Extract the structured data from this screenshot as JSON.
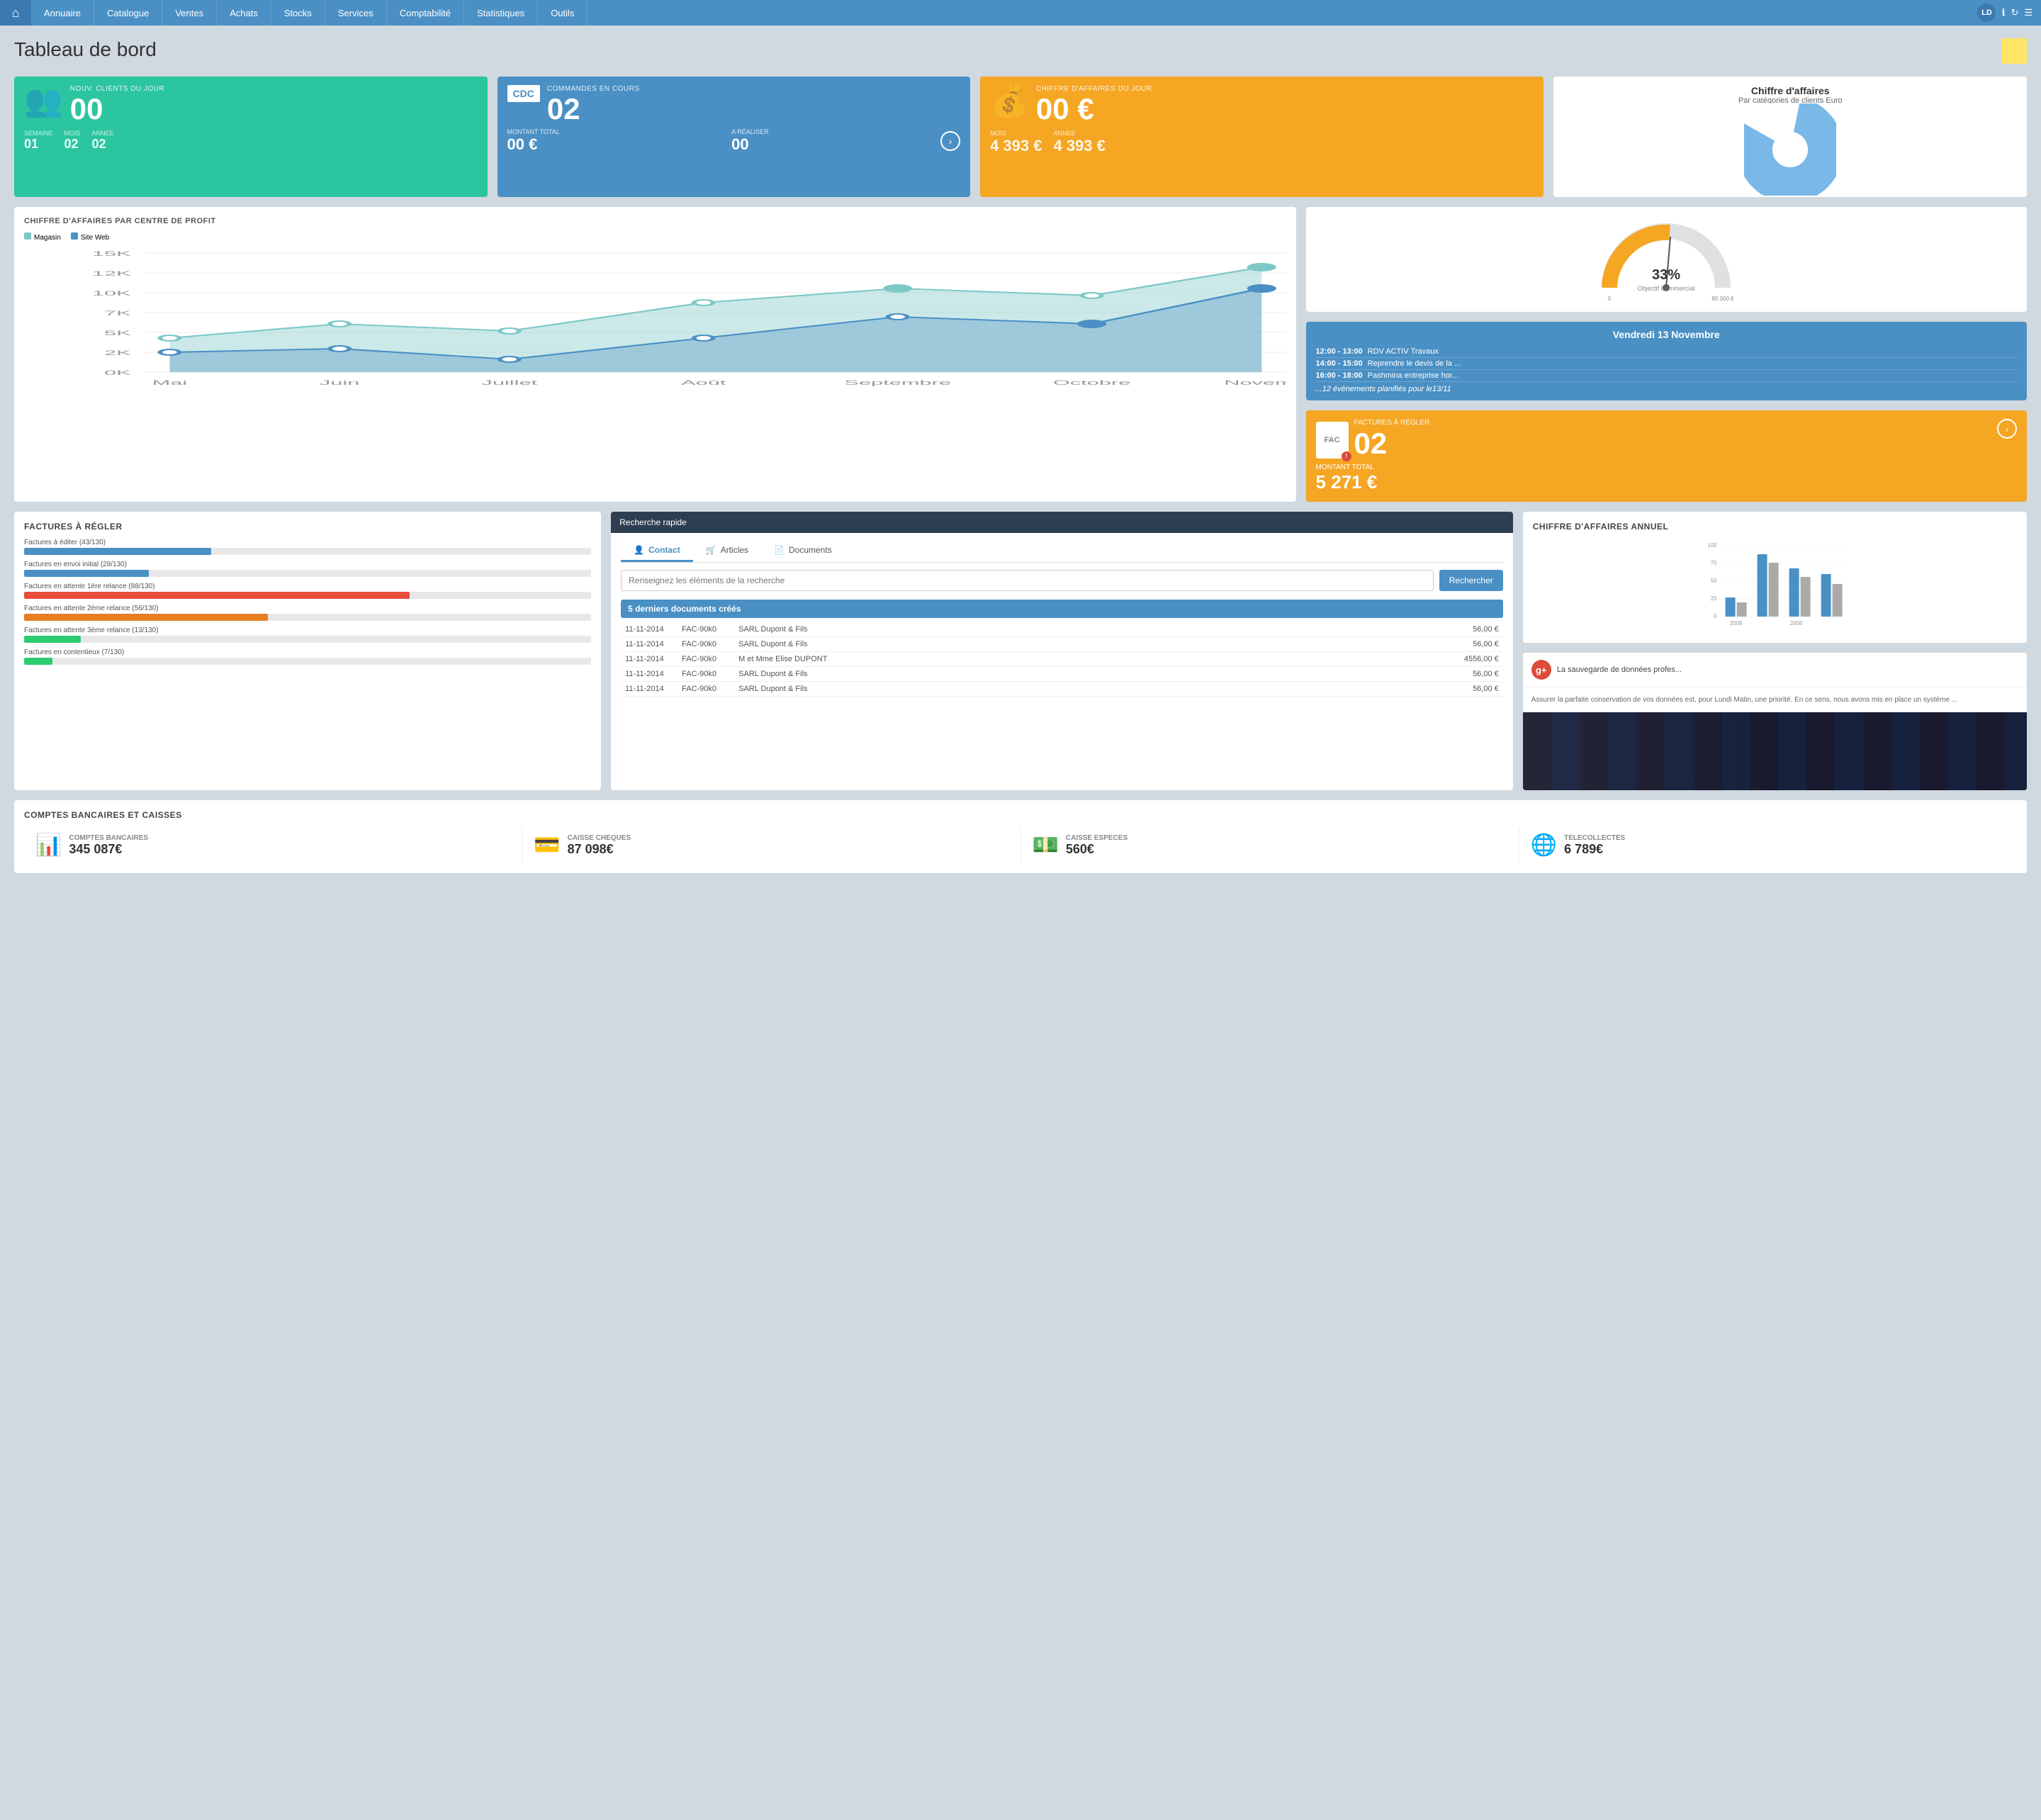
{
  "nav": {
    "home_icon": "⌂",
    "items": [
      "Annuaire",
      "Catalogue",
      "Ventes",
      "Achats",
      "Stocks",
      "Services",
      "Comptabilité",
      "Statistiques",
      "Outils"
    ],
    "user_initials": "LD"
  },
  "page": {
    "title": "Tableau de bord",
    "sticky_note": ""
  },
  "kpi_clients": {
    "label": "NOUV. CLIENTS DU JOUR",
    "value": "00",
    "sub_items": [
      {
        "label": "SEMAINE",
        "value": "01"
      },
      {
        "label": "MOIS",
        "value": "02"
      },
      {
        "label": "ANNEE",
        "value": "02"
      }
    ]
  },
  "kpi_commandes": {
    "badge": "CDC",
    "label": "COMMANDES EN COURS",
    "value": "02",
    "footer_montant_label": "MONTANT TOTAL",
    "footer_montant_value": "00 €",
    "footer_realiser_label": "A RÉALISER",
    "footer_realiser_value": "00"
  },
  "kpi_ca": {
    "label": "CHIFFRE D'AFFAIRES DU JOUR",
    "value": "00 €",
    "mois_label": "MOIS",
    "mois_value": "4 393 €",
    "annee_label": "ANNEE",
    "annee_value": "4 393 €"
  },
  "chiffre_affaires_pie": {
    "title": "Chiffre d'affaires",
    "subtitle": "Par catégories de clients Euro"
  },
  "chart_profit": {
    "title": "CHIFFRE D'AFFAIRES PAR CENTRE DE PROFIT",
    "legend": [
      {
        "label": "Magasin",
        "color": "#7ec8c8"
      },
      {
        "label": "Site Web",
        "color": "#4a90c4"
      }
    ],
    "y_labels": [
      "15K",
      "12K",
      "10K",
      "7K",
      "5K",
      "2K",
      "0K"
    ],
    "x_labels": [
      "Mai",
      "Juin",
      "Juillet",
      "Août",
      "Septembre",
      "Octobre",
      "Novem."
    ]
  },
  "gauge": {
    "percent": "33%",
    "label": "Objectif Commercial",
    "min": "0",
    "max": "80 000 €"
  },
  "calendar": {
    "date": "Vendredi 13 Novembre",
    "events": [
      {
        "time": "12:00 - 13:00",
        "title": "RDV ACTIV Travaux"
      },
      {
        "time": "14:00 - 15:00",
        "title": "Reprendre le devis de la ..."
      },
      {
        "time": "16:00 - 18:00",
        "title": "Pashmina entreprise hor..."
      }
    ],
    "more": "...12 évènements planifiés pour le13/11"
  },
  "fac_card": {
    "badge": "FAC",
    "label": "FACTURES À RÉGLER",
    "value": "02",
    "footer_label": "MONTANT TOTAL",
    "footer_amount": "5 271 €"
  },
  "factures": {
    "title": "FACTURES À RÉGLER",
    "items": [
      {
        "label": "Factures à éditer (43/130)",
        "percent": 33,
        "color": "#4a90c4"
      },
      {
        "label": "Factures en envoi initial (28/130)",
        "percent": 22,
        "color": "#4a90c4"
      },
      {
        "label": "Factures en attente 1ère relance (88/130)",
        "percent": 68,
        "color": "#e74c3c"
      },
      {
        "label": "Factures en attente 2ème relance (56/130)",
        "percent": 43,
        "color": "#e67e22"
      },
      {
        "label": "Factures en attente 3ème relance (13/130)",
        "percent": 10,
        "color": "#2ecc71"
      },
      {
        "label": "Factures en contentieux (7/130)",
        "percent": 5,
        "color": "#2ecc71"
      }
    ]
  },
  "quick_search": {
    "header": "Recherche rapide",
    "tabs": [
      "Contact",
      "Articles",
      "Documents"
    ],
    "active_tab": 0,
    "input_placeholder": "Renseignez les éléments de la recherche",
    "button_label": "Rechercher",
    "recent_label": "5 derniers documents créés",
    "documents": [
      {
        "date": "11-11-2014",
        "ref": "FAC-90k0",
        "name": "SARL Dupont & Fils",
        "amount": "56,00 €"
      },
      {
        "date": "11-11-2014",
        "ref": "FAC-90k0",
        "name": "SARL Dupont & Fils",
        "amount": "56,00 €"
      },
      {
        "date": "11-11-2014",
        "ref": "FAC-90k0",
        "name": "M et Mme Elise DUPONT",
        "amount": "4556,00 €"
      },
      {
        "date": "11-11-2014",
        "ref": "FAC-90k0",
        "name": "SARL Dupont & Fils",
        "amount": "56,00 €"
      },
      {
        "date": "11-11-2014",
        "ref": "FAC-90k0",
        "name": "SARL Dupont & Fils",
        "amount": "56,00 €"
      }
    ]
  },
  "annual_chart": {
    "title": "CHIFFRE D'AFFAIRES ANNUEL",
    "y_labels": [
      "100",
      "75",
      "50",
      "25",
      "0"
    ],
    "x_labels": [
      "2006",
      "2008"
    ],
    "bars": [
      {
        "height_a": 28,
        "height_b": 20,
        "color_a": "#4a90c4",
        "color_b": "#aaa"
      },
      {
        "height_a": 75,
        "height_b": 62,
        "color_a": "#4a90c4",
        "color_b": "#aaa"
      },
      {
        "height_a": 58,
        "height_b": 45,
        "color_a": "#4a90c4",
        "color_b": "#aaa"
      },
      {
        "height_a": 50,
        "height_b": 38,
        "color_a": "#4a90c4",
        "color_b": "#aaa"
      }
    ]
  },
  "bank_accounts": {
    "title": "COMPTES BANCAIRES et CAISSES",
    "items": [
      {
        "label": "COMPTES BANCAIRES",
        "amount": "345 087€",
        "icon": "📊"
      },
      {
        "label": "CAISSE CHEQUES",
        "amount": "87 098€",
        "icon": "💳"
      },
      {
        "label": "CAISSE ESPECES",
        "amount": "560€",
        "icon": "💰"
      },
      {
        "label": "TELECOLLECTES",
        "amount": "6 789€",
        "icon": "🌐"
      }
    ]
  },
  "news": {
    "title": "La sauvegarde de données profes...",
    "body": "Assurer la parfaite conservation de vos données est, pour Lundi Matin, une priorité. En ce sens, nous avons mis en place un système ...",
    "gplus": "g+"
  }
}
